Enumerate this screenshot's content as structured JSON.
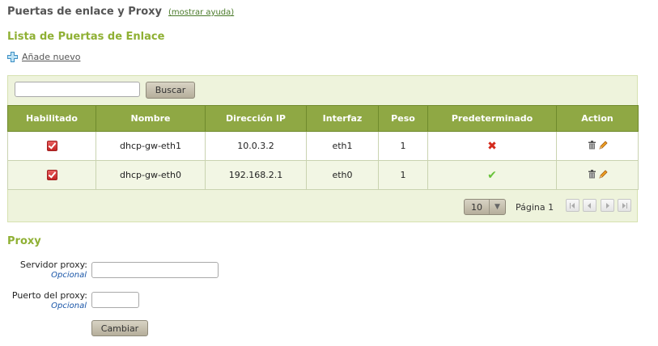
{
  "header": {
    "title": "Puertas de enlace y Proxy",
    "help_link": "(mostrar ayuda)"
  },
  "gateways": {
    "title": "Lista de Puertas de Enlace",
    "add_new": "Añade nuevo",
    "search": {
      "value": "",
      "placeholder": "",
      "button": "Buscar"
    },
    "columns": [
      "Habilitado",
      "Nombre",
      "Dirección IP",
      "Interfaz",
      "Peso",
      "Predeterminado",
      "Action"
    ],
    "rows": [
      {
        "enabled": true,
        "name": "dhcp-gw-eth1",
        "ip": "10.0.3.2",
        "interface": "eth1",
        "weight": "1",
        "default": false
      },
      {
        "enabled": true,
        "name": "dhcp-gw-eth0",
        "ip": "192.168.2.1",
        "interface": "eth0",
        "weight": "1",
        "default": true
      }
    ],
    "pager": {
      "page_size": "10",
      "page_label": "Página 1"
    }
  },
  "proxy": {
    "title": "Proxy",
    "server_label": "Servidor proxy:",
    "server_optional": "Opcional",
    "server_value": "",
    "port_label": "Puerto del proxy:",
    "port_optional": "Opcional",
    "port_value": "",
    "change_button": "Cambiar"
  },
  "colors": {
    "accent": "#8fb034",
    "header_bg": "#8fa844",
    "panel_bg": "#eef3dc",
    "link": "#1a56a8"
  },
  "icons": {
    "add": "plus-icon",
    "delete": "trash-icon",
    "edit": "pencil-icon",
    "disabled": "x-icon",
    "enabled": "check-icon"
  }
}
